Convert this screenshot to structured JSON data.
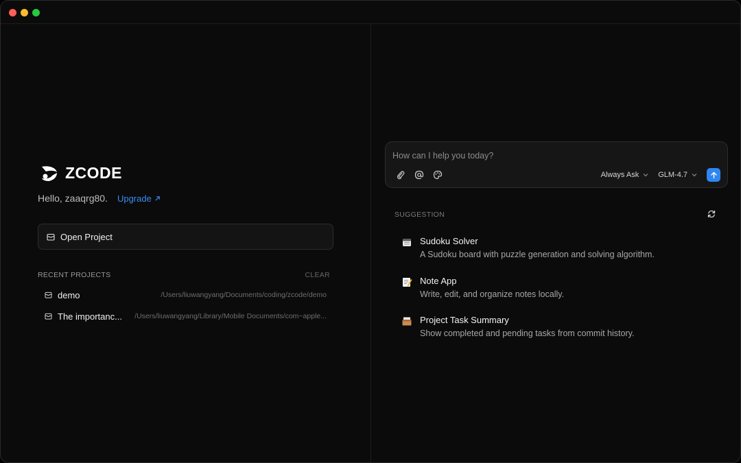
{
  "app": {
    "logo_text": "ZCODE",
    "greeting": "Hello, zaaqrg80.",
    "upgrade_label": "Upgrade"
  },
  "window_controls": [
    "close",
    "minimize",
    "maximize"
  ],
  "open_project": {
    "label": "Open Project",
    "icon": "folder-icon"
  },
  "recent": {
    "header": "RECENT PROJECTS",
    "clear_label": "CLEAR",
    "items": [
      {
        "name": "demo",
        "path": "/Users/liuwangyang/Documents/coding/zcode/demo"
      },
      {
        "name": "The importanc...",
        "path": "/Users/liuwangyang/Library/Mobile Documents/com~apple..."
      }
    ]
  },
  "chat": {
    "placeholder": "How can I help you today?",
    "tools": [
      "paperclip-icon",
      "at-icon",
      "palette-icon"
    ],
    "mode_label": "Always Ask",
    "model_label": "GLM-4.7",
    "send_icon": "arrow-up-icon",
    "accent": "#2f86f0"
  },
  "suggestions": {
    "header": "SUGGESTION",
    "items": [
      {
        "icon": "calendar-icon",
        "title": "Sudoku Solver",
        "desc": "A Sudoku board with puzzle generation and solving algorithm."
      },
      {
        "icon": "memo-icon",
        "title": "Note App",
        "desc": "Write, edit, and organize notes locally."
      },
      {
        "icon": "card-box-icon",
        "title": "Project Task Summary",
        "desc": "Show completed and pending tasks from commit history."
      }
    ]
  }
}
